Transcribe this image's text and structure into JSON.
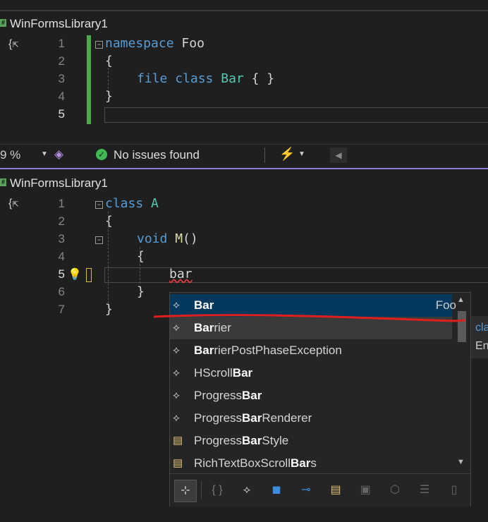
{
  "colors": {
    "background": "#1f1f1f",
    "keyword": "#569cd6",
    "type": "#4ec9b0",
    "method": "#dcdcaa",
    "green_margin": "#4ea94e",
    "accent": "#8b7ad9",
    "red_annotation": "#e01e1e"
  },
  "top_editor": {
    "tab_title": "WinFormsLibrary1",
    "line_numbers": [
      "1",
      "2",
      "3",
      "4",
      "5"
    ],
    "lines": {
      "l1_kw": "namespace",
      "l1_name": "Foo",
      "l2": "{",
      "l3_kw1": "file",
      "l3_kw2": "class",
      "l3_type": "Bar",
      "l3_rest": "{ }",
      "l4": "}"
    }
  },
  "status_bar": {
    "zoom": "9 %",
    "issues": "No issues found",
    "check_icon": "check-circle-icon",
    "brush_icon": "code-cleanup-icon"
  },
  "bottom_editor": {
    "tab_title": "WinFormsLibrary1",
    "line_numbers": [
      "1",
      "2",
      "3",
      "4",
      "5",
      "6",
      "7"
    ],
    "lines": {
      "l1_kw": "class",
      "l1_type": "A",
      "l2": "{",
      "l3_kw": "void",
      "l3_fn": "M",
      "l3_rest": "()",
      "l4": "{",
      "l5": "bar",
      "l6": "}",
      "l7": "}"
    }
  },
  "completion": {
    "items": [
      {
        "bold": "Bar",
        "rest": "",
        "prefix": "",
        "ns": "Foo",
        "icon": "class-icon"
      },
      {
        "bold": "Bar",
        "rest": "rier",
        "prefix": "",
        "icon": "class-icon"
      },
      {
        "bold": "Bar",
        "rest": "rierPostPhaseException",
        "prefix": "",
        "icon": "class-icon"
      },
      {
        "bold": "Bar",
        "rest": "",
        "prefix": "HScroll",
        "icon": "class-icon"
      },
      {
        "bold": "Bar",
        "rest": "",
        "prefix": "Progress",
        "icon": "class-icon"
      },
      {
        "bold": "Bar",
        "rest": "Renderer",
        "prefix": "Progress",
        "icon": "class-icon"
      },
      {
        "bold": "Bar",
        "rest": "Style",
        "prefix": "Progress",
        "icon": "enum-icon"
      },
      {
        "bold": "Bar",
        "rest": "s",
        "prefix": "RichTextBoxScroll",
        "icon": "enum-icon"
      }
    ],
    "side_panel": {
      "line1": "cla",
      "line2": "En"
    }
  }
}
